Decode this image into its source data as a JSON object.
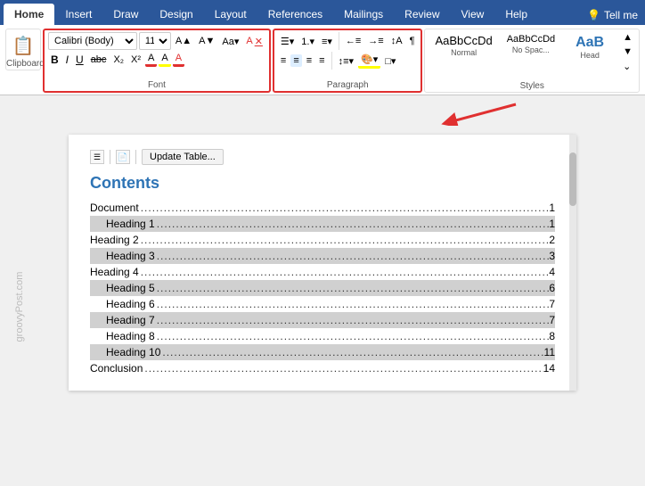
{
  "tabs": [
    {
      "label": "Home",
      "active": true
    },
    {
      "label": "Insert",
      "active": false
    },
    {
      "label": "Draw",
      "active": false
    },
    {
      "label": "Design",
      "active": false
    },
    {
      "label": "Layout",
      "active": false
    },
    {
      "label": "References",
      "active": false
    },
    {
      "label": "Mailings",
      "active": false
    },
    {
      "label": "Review",
      "active": false
    },
    {
      "label": "View",
      "active": false
    },
    {
      "label": "Help",
      "active": false
    }
  ],
  "tab_right": [
    "💡",
    "Tell me"
  ],
  "font": {
    "family": "Calibri (Body)",
    "size": "11",
    "label": "Font"
  },
  "paragraph_label": "Paragraph",
  "styles_label": "Styles",
  "styles": [
    {
      "id": "normal",
      "preview": "AaBbCcDd",
      "label": "Normal",
      "class": "style-normal"
    },
    {
      "id": "nospace",
      "preview": "AaBbCcDd",
      "label": "No Spac...",
      "class": "style-nospace"
    },
    {
      "id": "head",
      "preview": "AaB",
      "label": "Head",
      "class": "style-head"
    }
  ],
  "toc_toolbar": {
    "update_btn": "Update Table..."
  },
  "document": {
    "title": "Contents",
    "entries": [
      {
        "text": "Document",
        "page": "1",
        "indent": 0,
        "alt": false
      },
      {
        "text": "Heading 1",
        "page": "1",
        "indent": 1,
        "alt": true
      },
      {
        "text": "Heading 2",
        "page": "2",
        "indent": 0,
        "alt": false
      },
      {
        "text": "Heading 3",
        "page": "3",
        "indent": 1,
        "alt": true
      },
      {
        "text": "Heading 4",
        "page": "4",
        "indent": 0,
        "alt": false
      },
      {
        "text": "Heading 5",
        "page": "6",
        "indent": 1,
        "alt": true
      },
      {
        "text": "Heading 6",
        "page": "7",
        "indent": 1,
        "alt": false
      },
      {
        "text": "Heading 7",
        "page": "7",
        "indent": 1,
        "alt": true
      },
      {
        "text": "Heading 8",
        "page": "8",
        "indent": 1,
        "alt": false
      },
      {
        "text": "Heading 10",
        "page": "11",
        "indent": 1,
        "alt": true
      },
      {
        "text": "Conclusion",
        "page": "14",
        "indent": 0,
        "alt": false
      }
    ]
  },
  "watermark": "groovyPost.com"
}
